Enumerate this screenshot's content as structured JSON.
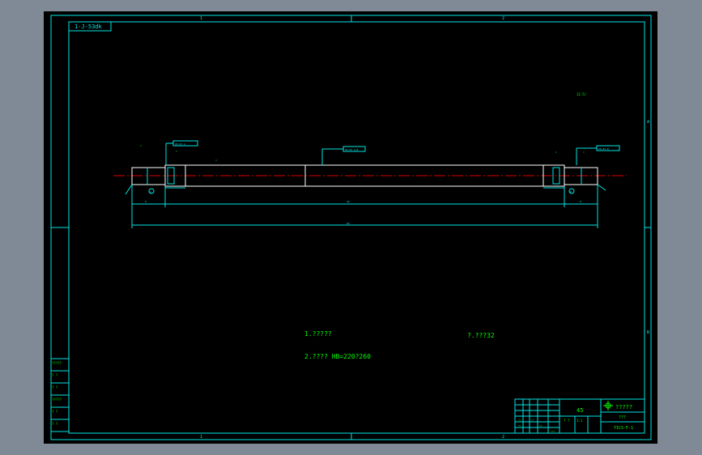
{
  "colors": {
    "window_bg": "#7f8a96",
    "drawing_bg": "#000000",
    "frame": "#00e5e5",
    "part_outline": "#ffffff",
    "centerline": "#e00000",
    "text_green": "#00ff00",
    "text_cyan": "#00e5e5"
  },
  "frame": {
    "zone_top_1": "1",
    "zone_top_2": "2",
    "zone_bottom_1": "1",
    "zone_bottom_2": "2",
    "zone_right_a": "A",
    "zone_right_b": "B",
    "drawing_code_box": "1-J-53dk"
  },
  "annotations": {
    "roughness_top_right": "12.5/",
    "tolerance_left": "⌀0.02 A",
    "tolerance_mid": "⌀0.03 A-B",
    "tolerance_right": "⌀0.02 B",
    "datum_left": "A",
    "datum_right": "B",
    "dim_total": "60",
    "dim_middle": "40",
    "dim_left_small": "8",
    "dim_right_small": "8"
  },
  "notes": {
    "note_1": "1.?????",
    "note_2": "2.???? HB=220?260",
    "note_3": "?.???32"
  },
  "left_stamp": {
    "rows": [
      "?????",
      "? ?",
      "? ?",
      "?????",
      "? ?",
      "? ?"
    ]
  },
  "title_block": {
    "material": "45",
    "company": "?????",
    "part_name": "???",
    "drawing_no": "YICS-F-1",
    "scale": "1:1",
    "sheet": "? ?"
  }
}
